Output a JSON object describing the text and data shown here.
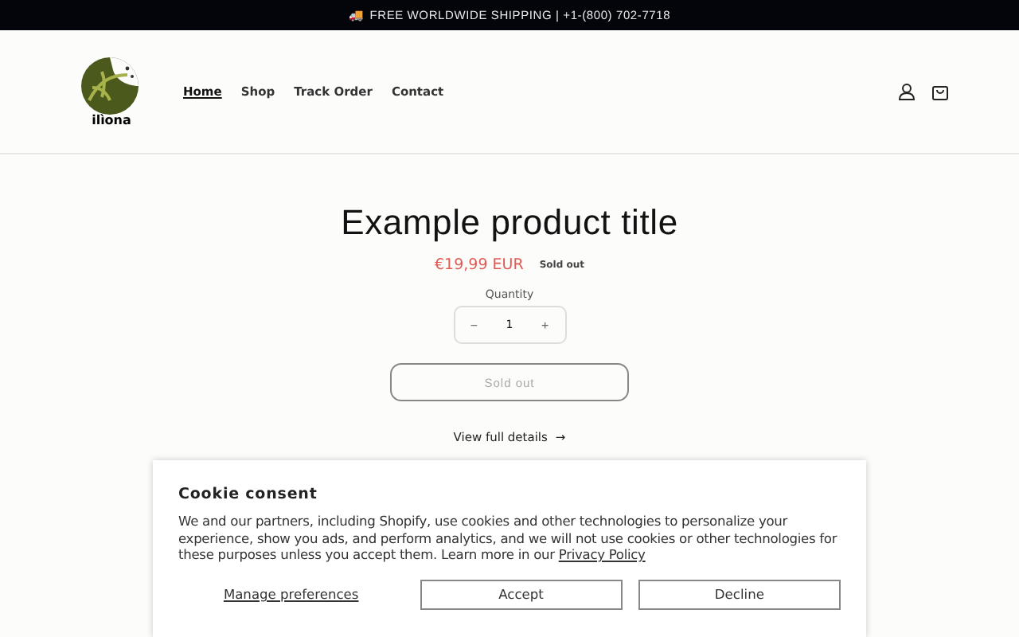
{
  "announcement": {
    "icon": "🚚",
    "text": "FREE WORLDWIDE SHIPPING | +1-(800) 702-7718"
  },
  "header": {
    "logo_text": "ilìona",
    "nav": [
      {
        "label": "Home",
        "selected": true
      },
      {
        "label": "Shop",
        "selected": false
      },
      {
        "label": "Track Order",
        "selected": false
      },
      {
        "label": "Contact",
        "selected": false
      }
    ]
  },
  "product": {
    "title": "Example product title",
    "price": "€19,99 EUR",
    "badge": "Sold out",
    "quantity_label": "Quantity",
    "minus": "−",
    "quantity": "1",
    "plus": "+",
    "button": {
      "label": "Sold out",
      "disabled": true
    },
    "details_link": "View full details",
    "details_arrow": "→"
  },
  "cookie": {
    "title": "Cookie consent",
    "text": "We and our partners, including Shopify, use cookies and other technologies to personalize your experience, show you ads, and perform analytics, and we will not use cookies or other technologies for these purposes unless you accept them. Learn more in our ",
    "link": "Privacy Policy",
    "manage": "Manage preferences",
    "buttons": [
      "Accept",
      "Decline"
    ]
  }
}
